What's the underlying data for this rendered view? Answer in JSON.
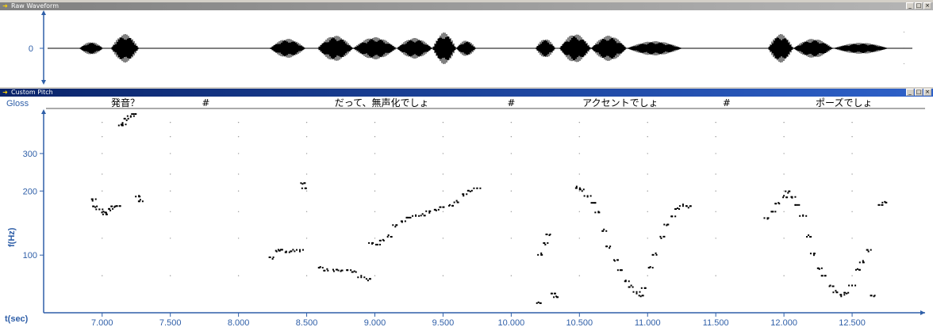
{
  "waveform_window": {
    "title": "Raw Waveform",
    "y_tick": "0",
    "controls": {
      "minimize": "_",
      "maximize": "□",
      "close": "×"
    }
  },
  "pitch_window": {
    "title": "Custom Pitch",
    "controls": {
      "minimize": "_",
      "maximize": "□",
      "close": "×"
    },
    "gloss_label": "Gloss",
    "gloss_segments": [
      {
        "text": "発音？",
        "t": 7.17
      },
      {
        "text": "#",
        "t": 7.76
      },
      {
        "text": "だって、無声化でしょ",
        "t": 9.05
      },
      {
        "text": "#",
        "t": 10.0
      },
      {
        "text": "アクセントでしょ",
        "t": 10.8
      },
      {
        "text": "#",
        "t": 11.58
      },
      {
        "text": "ポーズでしょ",
        "t": 12.44
      }
    ],
    "y_axis_label": "f(Hz)",
    "x_axis_label": "t(sec)"
  },
  "chart_data": {
    "type": "scatter",
    "xlabel": "t(sec)",
    "ylabel": "f(Hz)",
    "xlim": [
      6.6,
      13.0
    ],
    "ylim": [
      55,
      460
    ],
    "y_scale": "log",
    "x_ticks": [
      "7.000",
      "7.500",
      "8.000",
      "8.500",
      "9.000",
      "9.500",
      "10.000",
      "10.500",
      "11.000",
      "11.500",
      "12.000",
      "12.500"
    ],
    "y_ticks": [
      "100",
      "200",
      "300"
    ],
    "grid": "dotted",
    "point_color": "#000000",
    "axis_color": "#2f5fa8",
    "series": [
      {
        "x": [
          6.93,
          6.95,
          6.98,
          7.01,
          7.03,
          7.06,
          7.09,
          7.11,
          7.14,
          7.15,
          7.18,
          7.21,
          7.23,
          7.27,
          7.28,
          8.25,
          8.28,
          8.31,
          8.35,
          8.4,
          8.45,
          8.47,
          8.49,
          8.6,
          8.65,
          8.7,
          8.75,
          8.8,
          8.85,
          8.9,
          8.95,
          8.98,
          9.02,
          9.06,
          9.1,
          9.15,
          9.2,
          9.25,
          9.3,
          9.35,
          9.4,
          9.45,
          9.5,
          9.55,
          9.6,
          9.65,
          9.7,
          9.75,
          10.2,
          10.22,
          10.25,
          10.28,
          10.3,
          10.33,
          10.48,
          10.52,
          10.56,
          10.6,
          10.64,
          10.68,
          10.72,
          10.76,
          10.8,
          10.84,
          10.88,
          10.92,
          10.95,
          10.98,
          11.02,
          11.06,
          11.1,
          11.14,
          11.18,
          11.22,
          11.26,
          11.3,
          11.88,
          11.92,
          11.96,
          12.0,
          12.03,
          12.06,
          12.1,
          12.14,
          12.18,
          12.22,
          12.26,
          12.3,
          12.34,
          12.38,
          12.42,
          12.46,
          12.5,
          12.54,
          12.58,
          12.62,
          12.66,
          12.7,
          12.74
        ],
        "y": [
          180,
          168,
          164,
          160,
          158,
          162,
          168,
          170,
          410,
          418,
          430,
          446,
          460,
          190,
          182,
          96,
          104,
          106,
          104,
          106,
          104,
          216,
          206,
          88,
          86,
          84,
          84,
          85,
          84,
          80,
          76,
          113,
          112,
          118,
          124,
          136,
          143,
          150,
          154,
          156,
          158,
          162,
          168,
          172,
          180,
          190,
          199,
          206,
          60,
          102,
          112,
          124,
          66,
          64,
          210,
          200,
          188,
          176,
          160,
          132,
          108,
          94,
          85,
          76,
          72,
          66,
          64,
          70,
          88,
          102,
          120,
          138,
          152,
          166,
          173,
          167,
          148,
          160,
          176,
          190,
          196,
          186,
          172,
          154,
          124,
          100,
          86,
          80,
          72,
          68,
          64,
          66,
          72,
          86,
          94,
          104,
          64,
          172,
          178
        ]
      }
    ]
  }
}
